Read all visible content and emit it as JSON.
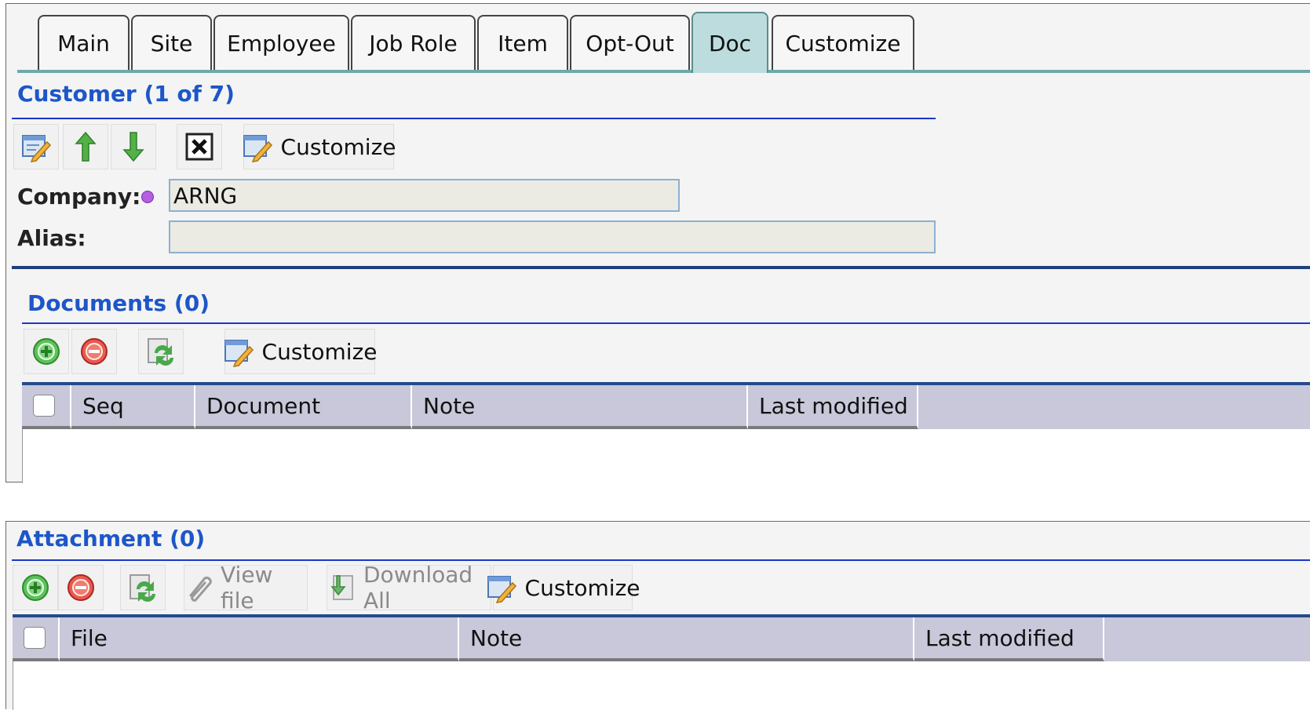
{
  "tabs": [
    "Main",
    "Site",
    "Employee",
    "Job Role",
    "Item",
    "Opt-Out",
    "Doc",
    "Customize"
  ],
  "active_tab": "Doc",
  "customer": {
    "title": "Customer (1 of 7)",
    "toolbar": {
      "customize_label": "Customize"
    },
    "company_label": "Company:",
    "company_value": "ARNG",
    "alias_label": "Alias:",
    "alias_value": ""
  },
  "documents": {
    "title": "Documents (0)",
    "toolbar": {
      "customize_label": "Customize"
    },
    "columns": [
      "Seq",
      "Document",
      "Note",
      "Last modified"
    ]
  },
  "attachment": {
    "title": "Attachment (0)",
    "toolbar": {
      "view_file_label": "View file",
      "download_all_label": "Download All",
      "customize_label": "Customize"
    },
    "columns": [
      "File",
      "Note",
      "Last modified"
    ]
  },
  "icons": {
    "edit": "edit-form-icon",
    "up": "up-arrow-icon",
    "down": "down-arrow-icon",
    "close": "close-box-icon",
    "customize": "customize-icon",
    "add": "add-icon",
    "remove": "remove-icon",
    "refresh": "refresh-icon",
    "view_file": "paperclip-icon",
    "download": "download-icon"
  },
  "colors": {
    "title_blue": "#1d56c9",
    "tab_active": "#bcdcdd",
    "header_bg": "#c8c8da"
  }
}
